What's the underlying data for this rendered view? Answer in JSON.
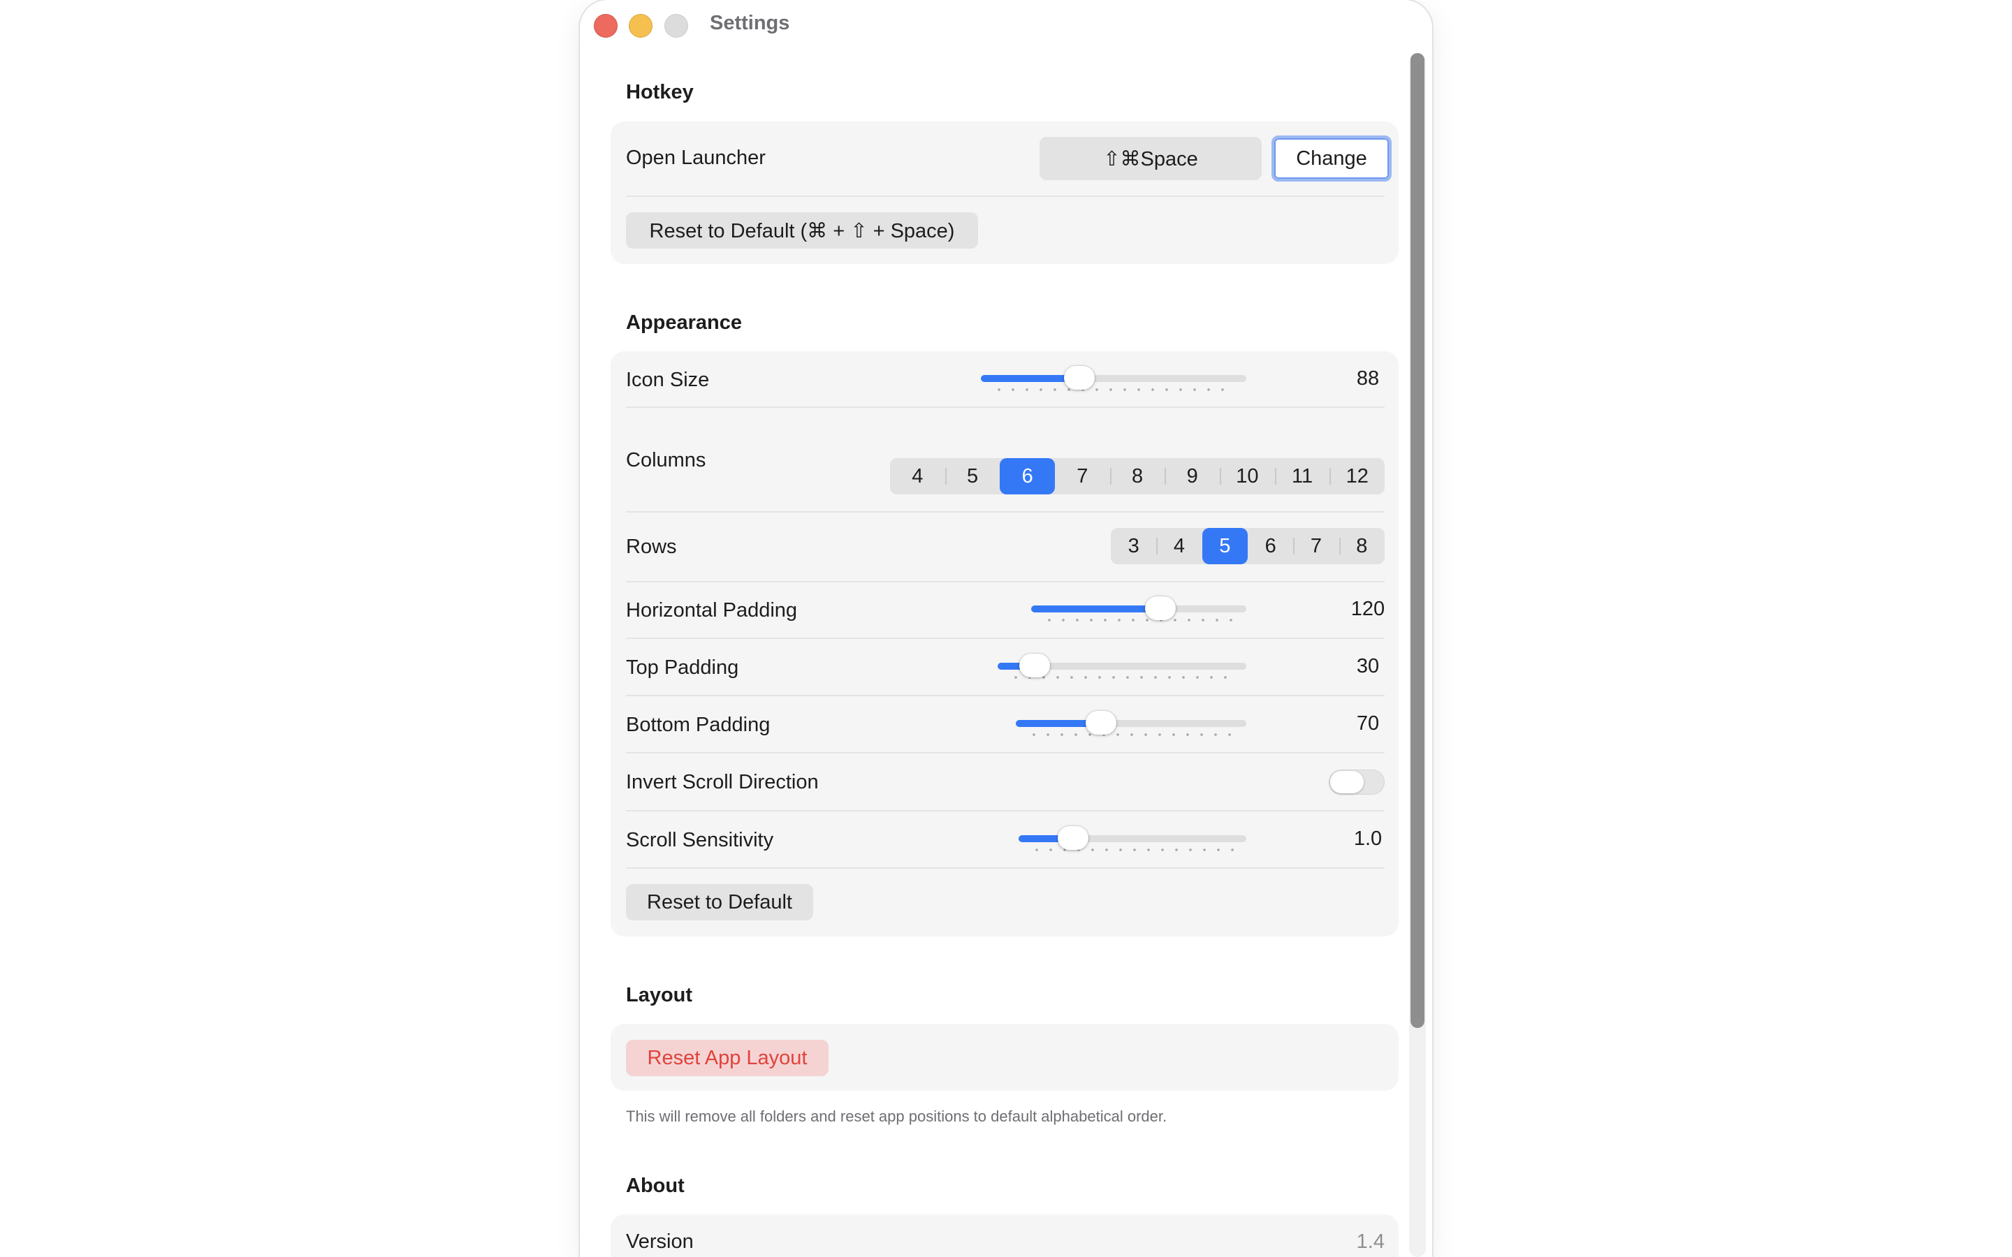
{
  "window": {
    "title": "Settings"
  },
  "hotkey": {
    "section_title": "Hotkey",
    "open_launcher_label": "Open Launcher",
    "shortcut_display": "⇧⌘Space",
    "change_label": "Change",
    "reset_label": "Reset to Default (⌘ + ⇧ + Space)"
  },
  "appearance": {
    "section_title": "Appearance",
    "icon_size": {
      "label": "Icon Size",
      "value": "88",
      "fraction": 0.37
    },
    "columns": {
      "label": "Columns",
      "options": [
        "4",
        "5",
        "6",
        "7",
        "8",
        "9",
        "10",
        "11",
        "12"
      ],
      "selected": "6"
    },
    "rows": {
      "label": "Rows",
      "options": [
        "3",
        "4",
        "5",
        "6",
        "7",
        "8"
      ],
      "selected": "5"
    },
    "horizontal_padding": {
      "label": "Horizontal Padding",
      "value": "120",
      "fraction": 0.6
    },
    "top_padding": {
      "label": "Top Padding",
      "value": "30",
      "fraction": 0.15
    },
    "bottom_padding": {
      "label": "Bottom Padding",
      "value": "70",
      "fraction": 0.37
    },
    "invert_scroll": {
      "label": "Invert Scroll Direction",
      "on": false
    },
    "scroll_sensitivity": {
      "label": "Scroll Sensitivity",
      "value": "1.0",
      "fraction": 0.24
    },
    "reset_label": "Reset to Default"
  },
  "layout": {
    "section_title": "Layout",
    "reset_app_layout_label": "Reset App Layout",
    "note": "This will remove all folders and reset app positions to default alphabetical order."
  },
  "about": {
    "section_title": "About",
    "version_label": "Version",
    "version_value": "1.4"
  },
  "colors": {
    "accent": "#3478f6",
    "danger": "#e0433b",
    "danger_bg": "#f5d3d3",
    "close": "#ed6a5e",
    "minimize": "#f5c04f"
  }
}
